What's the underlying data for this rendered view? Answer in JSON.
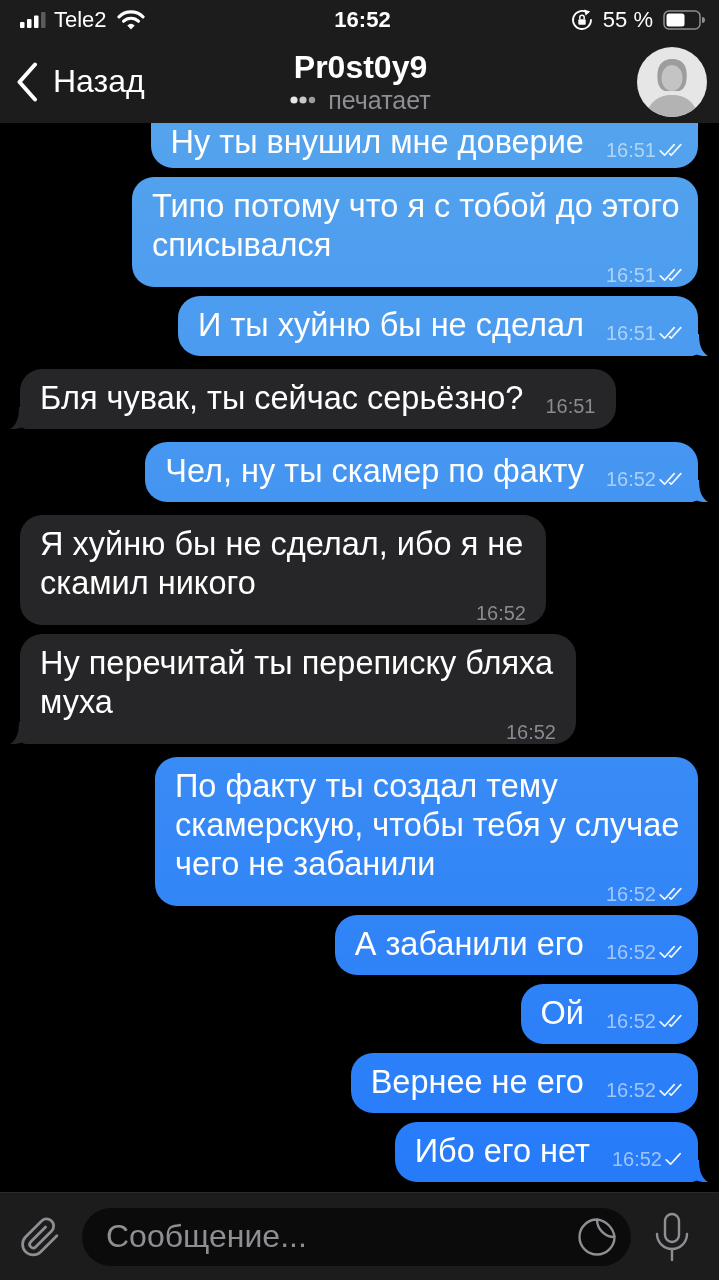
{
  "status_bar": {
    "carrier": "Tele2",
    "time": "16:52",
    "battery": "55 %"
  },
  "header": {
    "back": "Назад",
    "title": "Pr0st0y9",
    "subtitle": "печатает"
  },
  "messages": [
    {
      "kind": "outgoing",
      "text": "Ну ты внушил мне доверие",
      "time": "16:51",
      "read": true
    },
    {
      "kind": "outgoing",
      "text": "Типо потому что я с тобой до этого списывался",
      "time": "16:51",
      "read": true
    },
    {
      "kind": "outgoing",
      "text": "И ты хуйню бы не сделал",
      "time": "16:51",
      "read": true
    },
    {
      "kind": "incoming",
      "text": "Бля чувак, ты сейчас серьёзно?",
      "time": "16:51"
    },
    {
      "kind": "outgoing",
      "text": "Чел, ну ты скамер по факту",
      "time": "16:52",
      "read": true
    },
    {
      "kind": "incoming",
      "text": "Я хуйню бы не сделал, ибо я не скамил никого",
      "time": "16:52"
    },
    {
      "kind": "incoming",
      "text": "Ну перечитай ты переписку бляха муха",
      "time": "16:52"
    },
    {
      "kind": "outgoing",
      "text": "По факту ты создал тему скамерскую, чтобы тебя у случае чего не забанили",
      "time": "16:52",
      "read": true
    },
    {
      "kind": "outgoing",
      "text": "А забанили его",
      "time": "16:52",
      "read": true
    },
    {
      "kind": "outgoing",
      "text": "Ой",
      "time": "16:52",
      "read": true
    },
    {
      "kind": "outgoing",
      "text": "Вернее не его",
      "time": "16:52",
      "read": true
    },
    {
      "kind": "outgoing",
      "text": "Ибо его нет",
      "time": "16:52",
      "read": false
    }
  ],
  "composer": {
    "placeholder": "Сообщение..."
  }
}
